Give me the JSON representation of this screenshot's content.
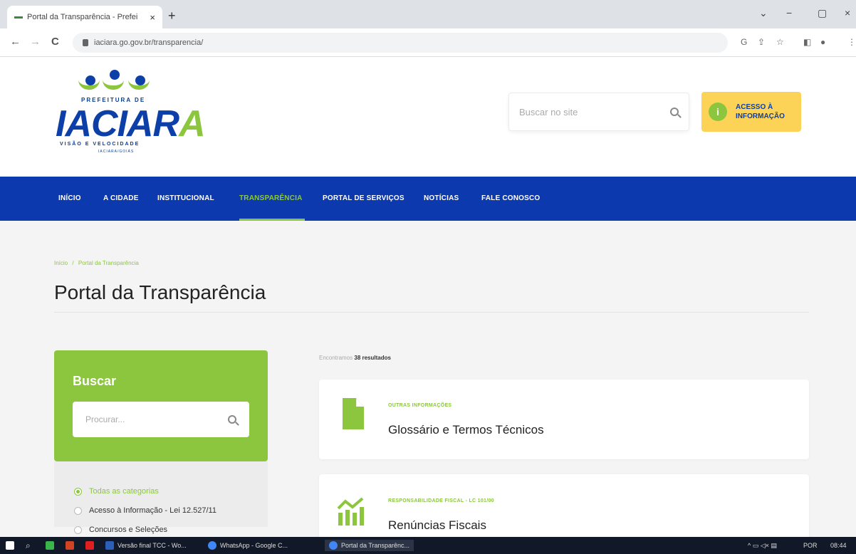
{
  "browser": {
    "tab_title": "Portal da Transparência - Prefei",
    "tab_close": "×",
    "new_tab": "+",
    "url": "iaciara.go.gov.br/transparencia/",
    "back": "←",
    "forward": "→",
    "reload": "C",
    "window_controls": [
      "⌄",
      "−",
      "▢",
      "×"
    ],
    "toolbar_icons": [
      "G",
      "⇪",
      "☆",
      "◧",
      "●",
      "⋮"
    ]
  },
  "logo": {
    "prefix": "PREFEITURA DE",
    "name_main": "IACIAR",
    "name_last": "A",
    "slogan": "VISÃO E VELOCIDADE",
    "sub": "IACIARA/GOIÁS"
  },
  "header": {
    "search_placeholder": "Buscar no site",
    "acesso_icon": "i",
    "acesso_label": "ACESSO À\nINFORMAÇÃO"
  },
  "nav": {
    "items": [
      "INÍCIO",
      "A CIDADE",
      "INSTITUCIONAL",
      "TRANSPARÊNCIA",
      "PORTAL DE SERVIÇOS",
      "NOTÍCIAS",
      "FALE CONOSCO"
    ],
    "active": "TRANSPARÊNCIA"
  },
  "breadcrumb": {
    "home": "Início",
    "sep": "/",
    "current": "Portal da Transparência"
  },
  "page": {
    "title": "Portal da Transparência"
  },
  "sidebar": {
    "heading": "Buscar",
    "search_placeholder": "Procurar...",
    "filters": [
      {
        "label": "Todas as categorias",
        "selected": true
      },
      {
        "label": "Acesso à Informação - Lei 12.527/11",
        "selected": false
      },
      {
        "label": "Concursos e Seleções",
        "selected": false
      }
    ]
  },
  "results": {
    "prefix": "Encontramos",
    "count": "38 resultados",
    "items": [
      {
        "category": "OUTRAS INFORMAÇÕES",
        "title": "Glossário e Termos Técnicos",
        "icon": "document-icon"
      },
      {
        "category": "RESPONSABILIDADE FISCAL - LC 101/00",
        "title": "Renúncias Fiscais",
        "icon": "chart-icon"
      }
    ]
  },
  "taskbar": {
    "apps": [
      "Versão final TCC - Wo...",
      "WhatsApp - Google C...",
      "Portal da Transparênc..."
    ],
    "lang": "POR",
    "time": "08:44",
    "tray": "^ ▭ ◁× ▤"
  },
  "colors": {
    "brand_blue": "#0c3aae",
    "brand_green": "#8cc63f",
    "acesso_yellow": "#fcd357"
  }
}
